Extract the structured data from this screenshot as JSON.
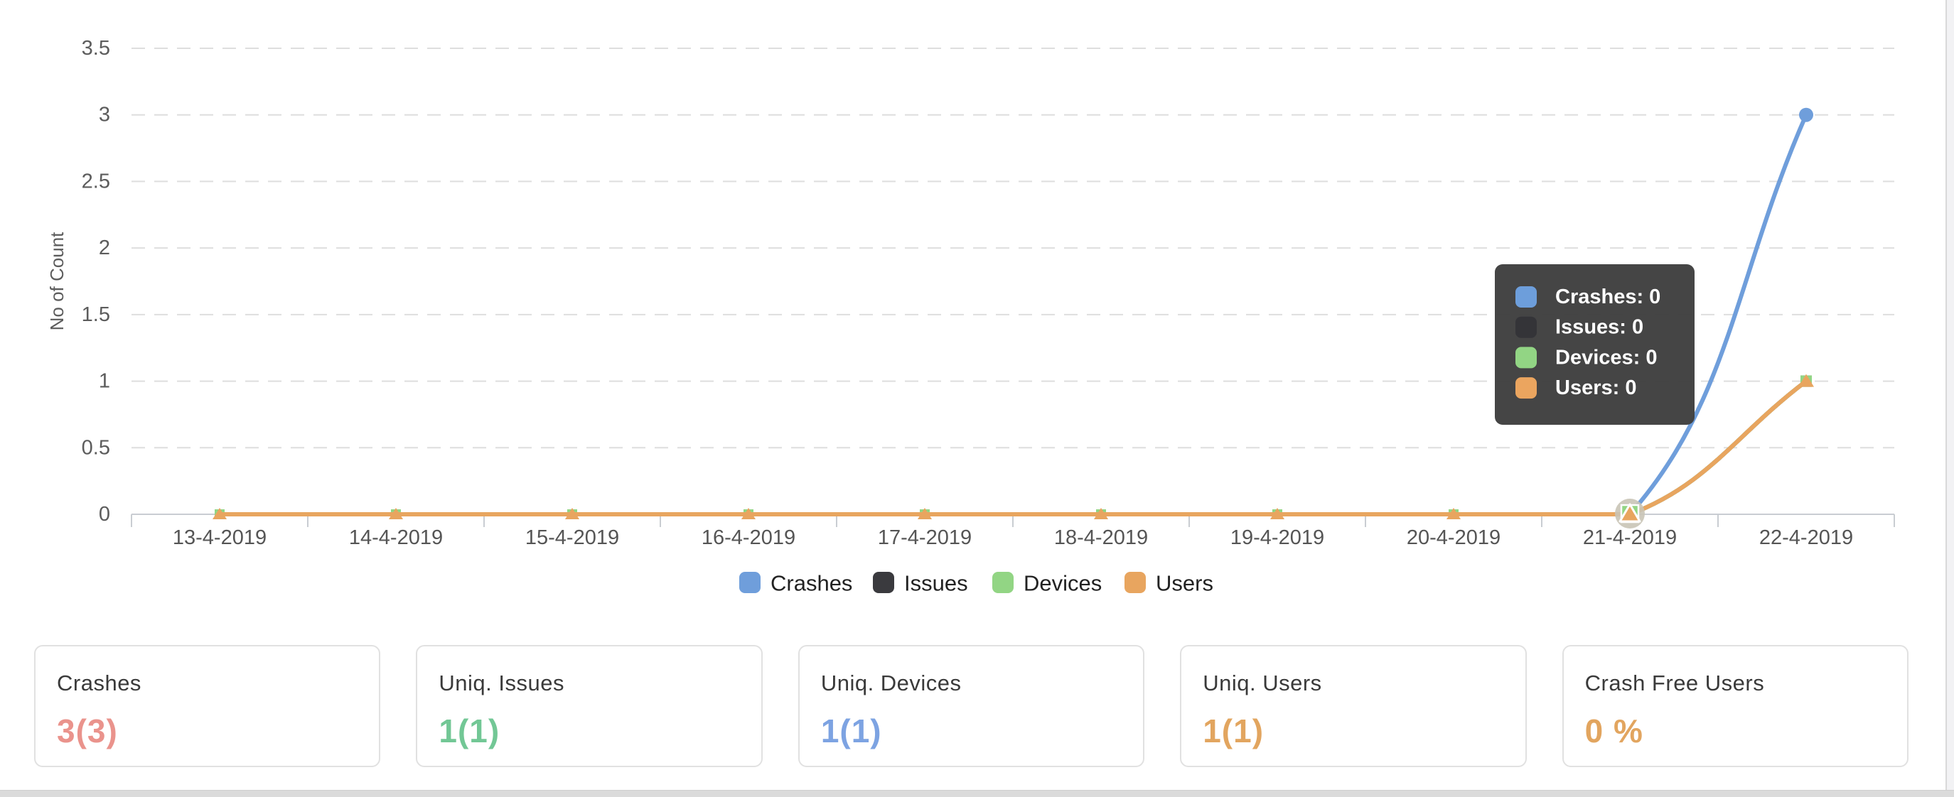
{
  "chart_data": {
    "type": "line",
    "title": "",
    "xlabel": "",
    "ylabel": "No of Count",
    "x": [
      "13-4-2019",
      "14-4-2019",
      "15-4-2019",
      "16-4-2019",
      "17-4-2019",
      "18-4-2019",
      "19-4-2019",
      "20-4-2019",
      "21-4-2019",
      "22-4-2019"
    ],
    "series": [
      {
        "name": "Crashes",
        "color": "#6f9edb",
        "marker": "circle",
        "values": [
          0,
          0,
          0,
          0,
          0,
          0,
          0,
          0,
          0,
          3
        ]
      },
      {
        "name": "Issues",
        "color": "#3a3a3e",
        "marker": "square",
        "values": [
          0,
          0,
          0,
          0,
          0,
          0,
          0,
          0,
          0,
          1
        ]
      },
      {
        "name": "Devices",
        "color": "#92d584",
        "marker": "square",
        "values": [
          0,
          0,
          0,
          0,
          0,
          0,
          0,
          0,
          0,
          1
        ]
      },
      {
        "name": "Users",
        "color": "#e8a55f",
        "marker": "triangle",
        "values": [
          0,
          0,
          0,
          0,
          0,
          0,
          0,
          0,
          0,
          1
        ]
      }
    ],
    "ylim": [
      0,
      3.5
    ],
    "yticks": [
      0,
      0.5,
      1,
      1.5,
      2,
      2.5,
      3,
      3.5
    ],
    "grid": true,
    "grid_style": "dashed",
    "legend_position": "bottom",
    "axis_color": "#c9cdd2",
    "grid_color": "#dedede",
    "tick_label_color": "#5c5c5c",
    "hover": {
      "index": 8,
      "category": "21-4-2019",
      "tooltip_bg": "#3f3f3f",
      "tooltip_rows": [
        {
          "label": "Crashes",
          "value": "0",
          "swatch": "#6d9edb"
        },
        {
          "label": "Issues",
          "value": "0",
          "swatch": "#343438"
        },
        {
          "label": "Devices",
          "value": "0",
          "swatch": "#92d584"
        },
        {
          "label": "Users",
          "value": "0",
          "swatch": "#eba55f"
        }
      ]
    }
  },
  "cards": [
    {
      "label": "Crashes",
      "value": "3(3)",
      "color": "#ea938c"
    },
    {
      "label": "Uniq. Issues",
      "value": "1(1)",
      "color": "#72c795"
    },
    {
      "label": "Uniq. Devices",
      "value": "1(1)",
      "color": "#7da3e2"
    },
    {
      "label": "Uniq. Users",
      "value": "1(1)",
      "color": "#e2a55f"
    },
    {
      "label": "Crash Free Users",
      "value": "0 %",
      "color": "#e2a55f"
    }
  ]
}
